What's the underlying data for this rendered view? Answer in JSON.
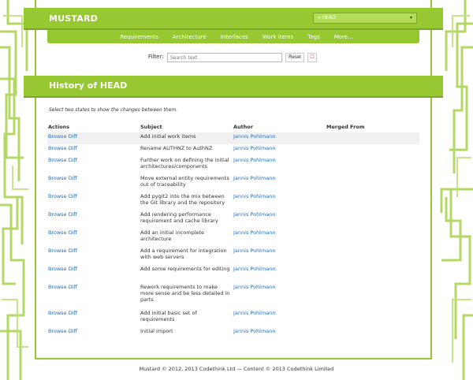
{
  "header": {
    "brand": "MUSTARD",
    "branch_selected": "» HEAD",
    "caret": "▾"
  },
  "nav": {
    "items": [
      "Requirements",
      "Architecture",
      "Interfaces",
      "Work Items",
      "Tags",
      "More..."
    ]
  },
  "filter": {
    "label": "Filter:",
    "placeholder": "Search text",
    "reset_label": "Reset",
    "clear_glyph": "☐"
  },
  "page_title": "History of HEAD",
  "instructions": "Select two states to show the changes between them.",
  "table": {
    "headers": [
      "Actions",
      "Subject",
      "Author",
      "Merged From"
    ],
    "action_label": "Browse Diff",
    "rows": [
      {
        "subject": "Add initial work items",
        "author": "Jannis Pohlmann",
        "merged": ""
      },
      {
        "subject": "Rename AUTHNZ to AuthNZ",
        "author": "Jannis Pohlmann",
        "merged": ""
      },
      {
        "subject": "Further work on defining the initial architectures/components",
        "author": "Jannis Pohlmann",
        "merged": ""
      },
      {
        "subject": "Move external entity requirements out of traceability",
        "author": "Jannis Pohlmann",
        "merged": ""
      },
      {
        "subject": "Add pygit2 into the mix between the Git library and the repository",
        "author": "Jannis Pohlmann",
        "merged": ""
      },
      {
        "subject": "Add rendering performance requirement and cache library",
        "author": "Jannis Pohlmann",
        "merged": ""
      },
      {
        "subject": "Add an initial incomplete architecture",
        "author": "Jannis Pohlmann",
        "merged": ""
      },
      {
        "subject": "Add a requirement for integration with web servers",
        "author": "Jannis Pohlmann",
        "merged": ""
      },
      {
        "subject": "Add some requirements for editing",
        "author": "Jannis Pohlmann",
        "merged": ""
      },
      {
        "subject": "Rework requirements to make more sense and be less detailed in parts",
        "author": "Jannis Pohlmann",
        "merged": ""
      },
      {
        "subject": "Add initial basic set of requirements",
        "author": "Jannis Pohlmann",
        "merged": ""
      },
      {
        "subject": "Initial import",
        "author": "Jannis Pohlmann",
        "merged": ""
      }
    ]
  },
  "footer": "Mustard © 2012, 2013 Codethink Ltd — Content © 2013 Codethink Limited",
  "colors": {
    "accent": "#96c832",
    "accent_dark": "#7aa825",
    "link": "#2a6fb4"
  }
}
